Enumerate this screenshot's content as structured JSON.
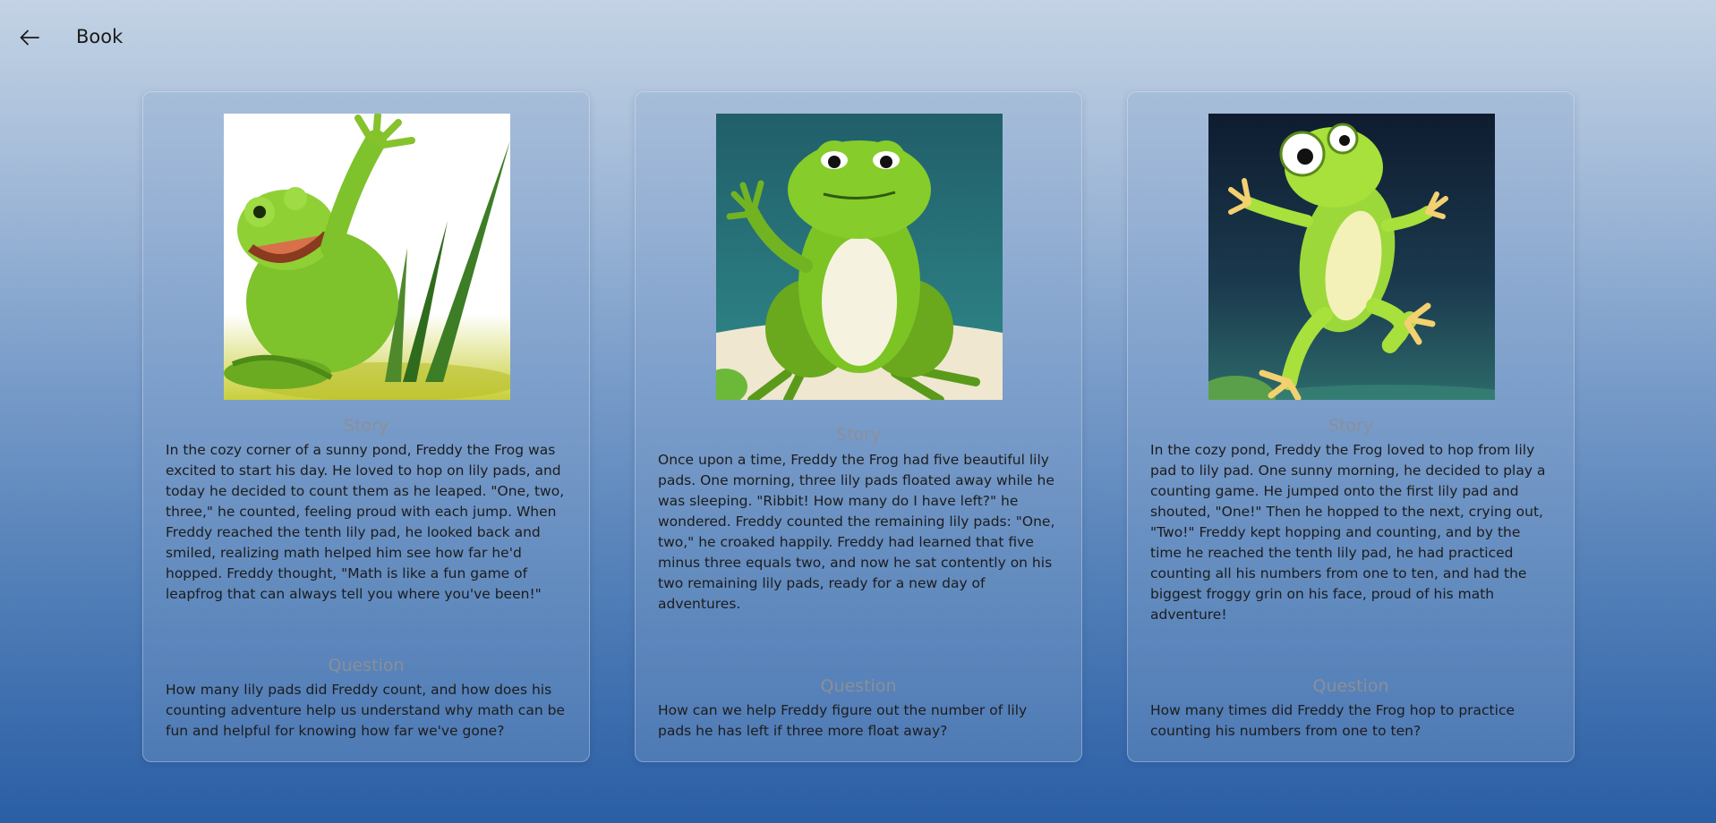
{
  "header": {
    "title": "Book",
    "back_icon": "arrow-left-icon"
  },
  "cards": [
    {
      "image": "frog-waving-in-grass",
      "story_heading": "Story",
      "story": "In the cozy corner of a sunny pond, Freddy the Frog was excited to start his day. He loved to hop on lily pads, and today he decided to count them as he leaped. \"One, two, three,\" he counted, feeling proud with each jump. When Freddy reached the tenth lily pad, he looked back and smiled, realizing math helped him see how far he'd hopped. Freddy thought, \"Math is like a fun game of leapfrog that can always tell you where you've been!\"",
      "question_heading": "Question",
      "question": "How many lily pads did Freddy count, and how does his counting adventure help us understand why math can be fun and helpful for knowing how far we've gone?"
    },
    {
      "image": "frog-sitting-on-lily-pad",
      "story_heading": "Story",
      "story": "Once upon a time, Freddy the Frog had five beautiful lily pads. One morning, three lily pads floated away while he was sleeping. \"Ribbit! How many do I have left?\" he wondered. Freddy counted the remaining lily pads: \"One, two,\" he croaked happily. Freddy had learned that five minus three equals two, and now he sat contently on his two remaining lily pads, ready for a new day of adventures.",
      "question_heading": "Question",
      "question": "How can we help Freddy figure out the number of lily pads he has left if three more float away?"
    },
    {
      "image": "frog-jumping-at-night",
      "story_heading": "Story",
      "story": "In the cozy pond, Freddy the Frog loved to hop from lily pad to lily pad. One sunny morning, he decided to play a counting game. He jumped onto the first lily pad and shouted, \"One!\" Then he hopped to the next, crying out, \"Two!\" Freddy kept hopping and counting, and by the time he reached the tenth lily pad, he had practiced counting all his numbers from one to ten, and had the biggest froggy grin on his face, proud of his math adventure!",
      "question_heading": "Question",
      "question": "How many times did Freddy the Frog hop to practice counting his numbers from one to ten?"
    }
  ]
}
